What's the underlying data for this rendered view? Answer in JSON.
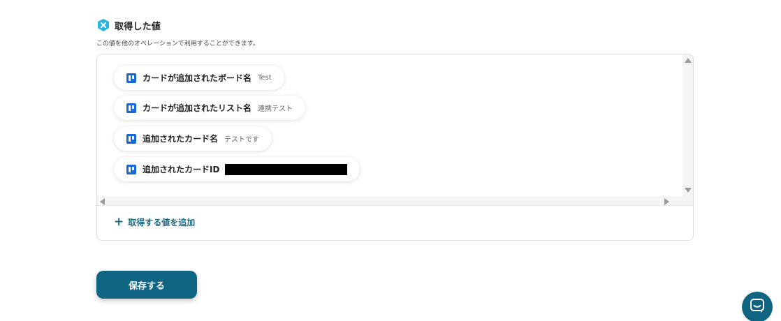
{
  "section": {
    "title": "取得した値",
    "description": "この値を他のオペレーションで利用することができます。"
  },
  "outputs": [
    {
      "label": "カードが追加されたボード名",
      "value": "Test",
      "icon": "trello-icon"
    },
    {
      "label": "カードが追加されたリスト名",
      "value": "連携テスト",
      "icon": "trello-icon"
    },
    {
      "label": "追加されたカード名",
      "value": "テストです",
      "icon": "trello-icon"
    },
    {
      "label": "追加されたカードID",
      "value": "",
      "icon": "trello-icon",
      "redacted": true
    }
  ],
  "add_link": {
    "label": "取得する値を追加",
    "icon": "plus-icon"
  },
  "save_button": {
    "label": "保存する"
  },
  "chat": {
    "icon": "chat-icon"
  },
  "colors": {
    "accent": "#0f6482",
    "link": "#1b6a86",
    "trello": "#1868db",
    "section_icon": "#29b6e0"
  }
}
